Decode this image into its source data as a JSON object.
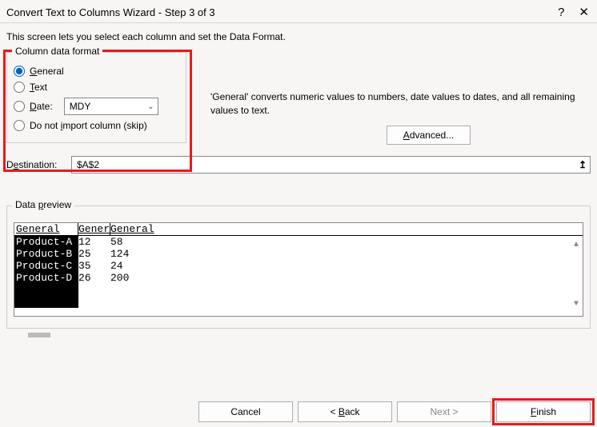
{
  "titlebar": {
    "title": "Convert Text to Columns Wizard - Step 3 of 3",
    "help": "?",
    "close": "✕"
  },
  "subtitle": "This screen lets you select each column and set the Data Format.",
  "format_group": {
    "legend": "Column data format",
    "general": "General",
    "text": "Text",
    "date": "Date:",
    "date_value": "MDY",
    "skip": "Do not import column (skip)"
  },
  "description": "'General' converts numeric values to numbers, date values to dates, and all remaining values to text.",
  "advanced_label": "Advanced...",
  "destination": {
    "label": "Destination:",
    "value": "$A$2"
  },
  "preview": {
    "legend": "Data preview",
    "headers": [
      "General",
      "Gener",
      "General"
    ],
    "rows": [
      [
        "Product-A",
        "12",
        "58"
      ],
      [
        "Product-B",
        "25",
        "124"
      ],
      [
        "Product-C",
        "35",
        "24"
      ],
      [
        "Product-D",
        "26",
        "200"
      ]
    ]
  },
  "buttons": {
    "cancel": "Cancel",
    "back": "< Back",
    "next": "Next >",
    "finish": "Finish"
  }
}
